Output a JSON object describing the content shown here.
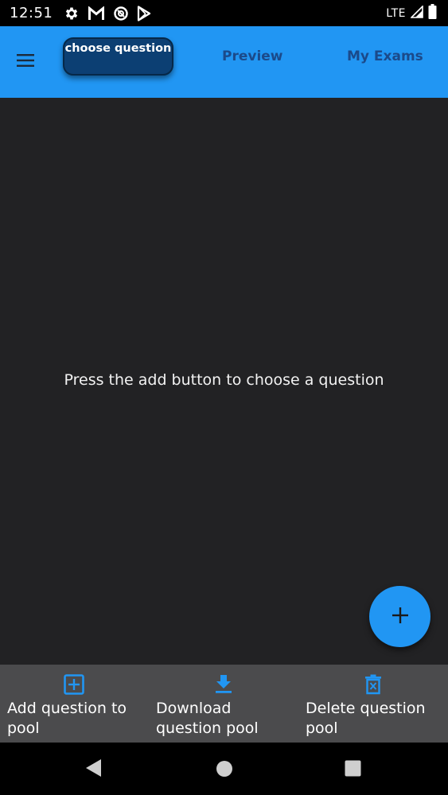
{
  "status_bar": {
    "time": "12:51",
    "network": "LTE",
    "icons": [
      "settings-icon",
      "gmail-icon",
      "data-saver-icon",
      "play-store-icon",
      "signal-icon",
      "battery-icon"
    ]
  },
  "app_bar": {
    "tabs": [
      {
        "label": "choose question",
        "active": true
      },
      {
        "label": "Preview",
        "active": false
      },
      {
        "label": "My Exams",
        "active": false
      }
    ],
    "colors": {
      "bar": "#2196f3",
      "active_tab": "#0c3f73",
      "inactive_text": "#1b4a8a"
    }
  },
  "main": {
    "empty_message": "Press the add button to choose a question",
    "fab_icon": "plus-icon"
  },
  "bottom_actions": [
    {
      "label": "Add question to pool",
      "icon": "add-box-icon"
    },
    {
      "label": "Download question pool",
      "icon": "download-icon"
    },
    {
      "label": "Delete question pool",
      "icon": "delete-icon"
    }
  ],
  "nav_bar": {
    "buttons": [
      "back-icon",
      "home-icon",
      "recents-icon"
    ]
  }
}
